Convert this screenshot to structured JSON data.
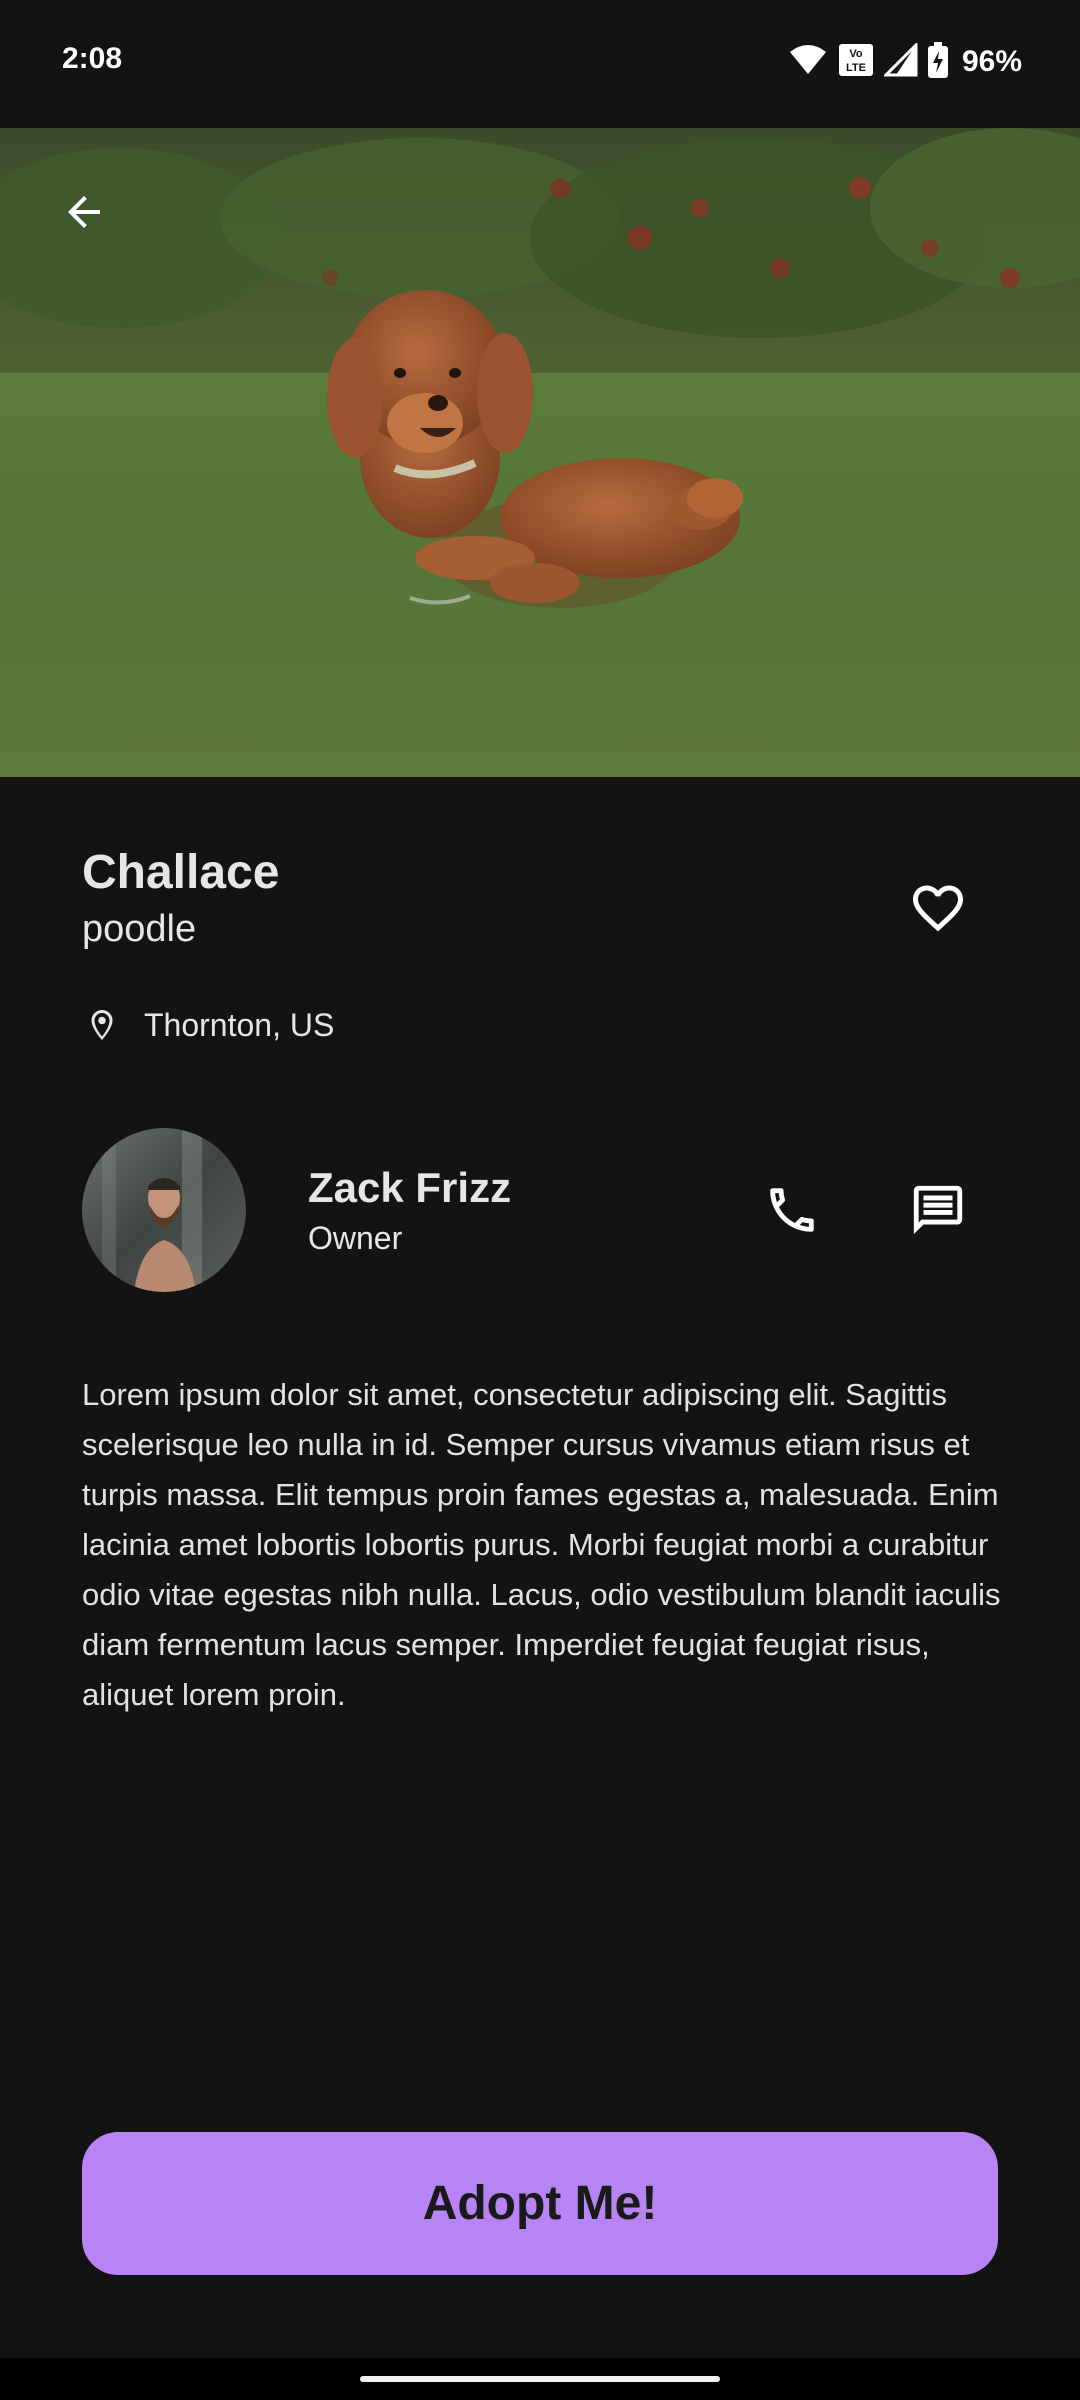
{
  "status_bar": {
    "time": "2:08",
    "battery_percent": "96%",
    "icons": [
      "wifi-icon",
      "volte-icon",
      "signal-icon",
      "battery-charging-icon"
    ]
  },
  "hero": {
    "image": "poodle-on-grass-photo",
    "back_icon": "arrow-back-icon"
  },
  "pet": {
    "name": "Challace",
    "breed": "poodle",
    "location": "Thornton, US",
    "favorite_icon": "heart-outline-icon",
    "location_icon": "location-pin-icon"
  },
  "owner": {
    "name": "Zack Frizz",
    "role": "Owner",
    "call_icon": "phone-icon",
    "message_icon": "message-icon"
  },
  "description": "Lorem ipsum dolor sit amet, consectetur adipiscing elit. Sagittis scelerisque leo nulla in id. Semper cursus vivamus etiam risus et turpis massa. Elit tempus proin fames egestas a, malesuada. Enim lacinia amet lobortis lobortis purus. Morbi feugiat morbi a curabitur odio vitae egestas nibh nulla. Lacus, odio vestibulum blandit iaculis diam fermentum lacus semper. Imperdiet feugiat feugiat risus, aliquet lorem proin.",
  "cta": {
    "label": "Adopt Me!"
  },
  "colors": {
    "background": "#131313",
    "accent": "#b884f5",
    "text": "#e6e6e6"
  }
}
